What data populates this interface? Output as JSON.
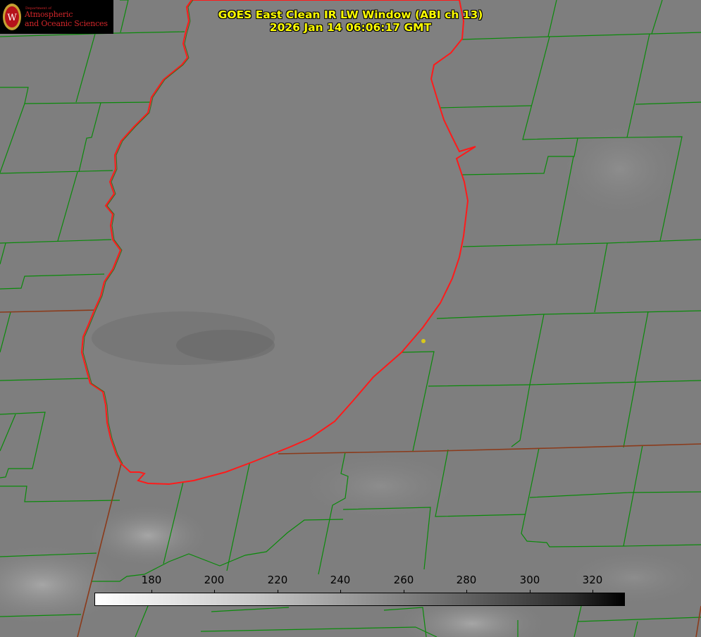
{
  "logo": {
    "department_label": "Department of",
    "line1": "Atmospheric",
    "line2": "and Oceanic Sciences",
    "seal_letter": "W"
  },
  "title": {
    "line1": "GOES East Clean IR LW Window (ABI ch 13)",
    "line2": "2026 Jan 14 06:06:17 GMT"
  },
  "colorbar": {
    "labels": [
      "180",
      "200",
      "220",
      "240",
      "260",
      "280",
      "300",
      "320"
    ],
    "values": [
      180,
      200,
      220,
      240,
      260,
      280,
      300,
      320
    ],
    "direction": "light-to-dark",
    "colors": {
      "low": "#ffffff",
      "high": "#000000"
    }
  },
  "map_colors": {
    "background": "#7f7f7f",
    "county_lines": "#0a8a0a",
    "state_lines": "#8b3a1a",
    "lake_outline": "#ff1a1a",
    "station_dot": "#d8c81a"
  }
}
